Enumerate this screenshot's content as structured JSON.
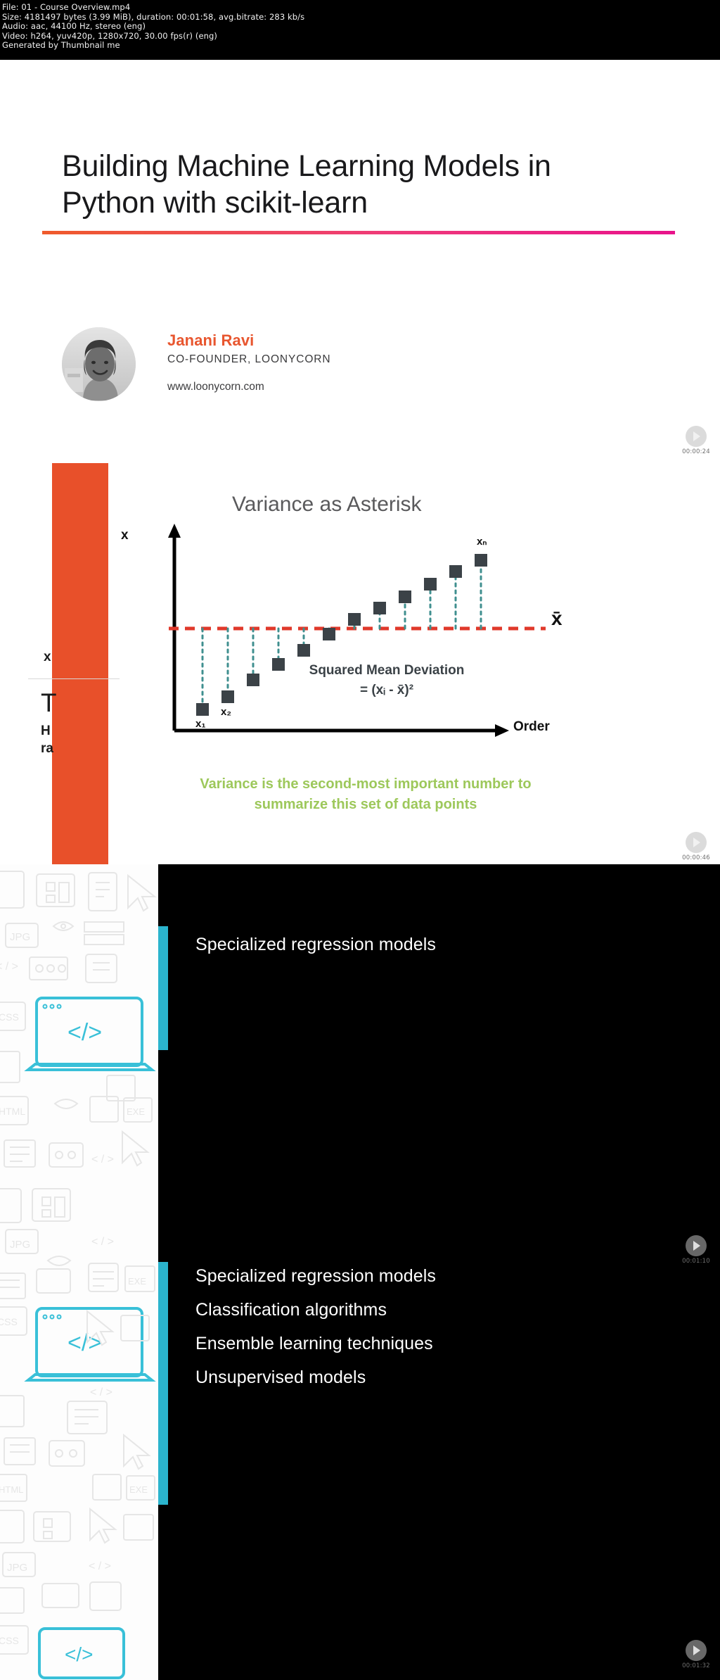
{
  "media_info": {
    "line1": "File: 01 - Course Overview.mp4",
    "line2": "Size: 4181497 bytes (3.99 MiB), duration: 00:01:58, avg.bitrate: 283 kb/s",
    "line3": "Audio: aac, 44100 Hz, stereo (eng)",
    "line4": "Video: h264, yuv420p, 1280x720, 30.00 fps(r) (eng)",
    "line5": "Generated by Thumbnail me"
  },
  "title_slide": {
    "title_line1": "Building Machine Learning Models in",
    "title_line2": "Python with scikit-learn",
    "author_name": "Janani Ravi",
    "author_role": "CO-FOUNDER, LOONYCORN",
    "author_site": "www.loonycorn.com",
    "accent_start": "#ef5b2b",
    "accent_end": "#e8138b",
    "author_name_color": "#e8562f"
  },
  "variance_slide": {
    "title": "Variance as Asterisk",
    "y_axis_label": "x",
    "x_axis_label": "Order",
    "mean_label": "x̄",
    "first_point_label": "x₁",
    "second_point_label": "x₂",
    "last_point_label": "xₙ",
    "formula_line1": "Squared Mean Deviation",
    "formula_line2": "= (xᵢ - x̄)²",
    "caption_line1": "Variance is the second-most important number to",
    "caption_line2": "summarize this set of data points",
    "caption_color": "#9dc85b",
    "mean_line_color": "#e0392b",
    "point_color": "#3b4247",
    "deviation_color": "#3f8f8f",
    "sidebar_color": "#e8502a",
    "ghost_text": {
      "x_mark": "x",
      "t_letter": "T",
      "h_letter": "H",
      "ra_letters": "ra"
    }
  },
  "chart_data": {
    "type": "scatter",
    "title": "Variance as Asterisk",
    "xlabel": "Order",
    "ylabel": "x",
    "grid": false,
    "legend": null,
    "annotations": [
      "Squared Mean Deviation",
      "= (xᵢ - x̄)²"
    ],
    "reference_line": {
      "label": "x̄",
      "value": 0,
      "style": "dashed",
      "color": "#e0392b"
    },
    "point_labels": [
      "x₁",
      "x₂",
      "",
      "",
      "",
      "",
      "",
      "",
      "",
      "",
      "",
      "xₙ"
    ],
    "x": [
      1,
      2,
      3,
      4,
      5,
      6,
      7,
      8,
      9,
      10,
      11,
      12
    ],
    "y": [
      -100,
      -84,
      -66,
      -50,
      -32,
      -14,
      2,
      12,
      22,
      34,
      46,
      58
    ],
    "ylim": [
      -115,
      75
    ],
    "xlim": [
      0,
      13
    ]
  },
  "dark_slide_a": {
    "bullets": [
      "Specialized regression models"
    ],
    "stripe_color": "#2bb4cd",
    "background": "#000000"
  },
  "dark_slide_b": {
    "bullets": [
      "Specialized regression models",
      "Classification algorithms",
      "Ensemble learning techniques",
      "Unsupervised models"
    ],
    "stripe_color": "#2bb4cd",
    "background": "#000000"
  },
  "timestamps": [
    {
      "id": "ts1",
      "label": "00:00:24"
    },
    {
      "id": "ts2",
      "label": "00:00:46"
    },
    {
      "id": "ts3",
      "label": "00:01:10"
    },
    {
      "id": "ts4",
      "label": "00:01:32"
    }
  ]
}
